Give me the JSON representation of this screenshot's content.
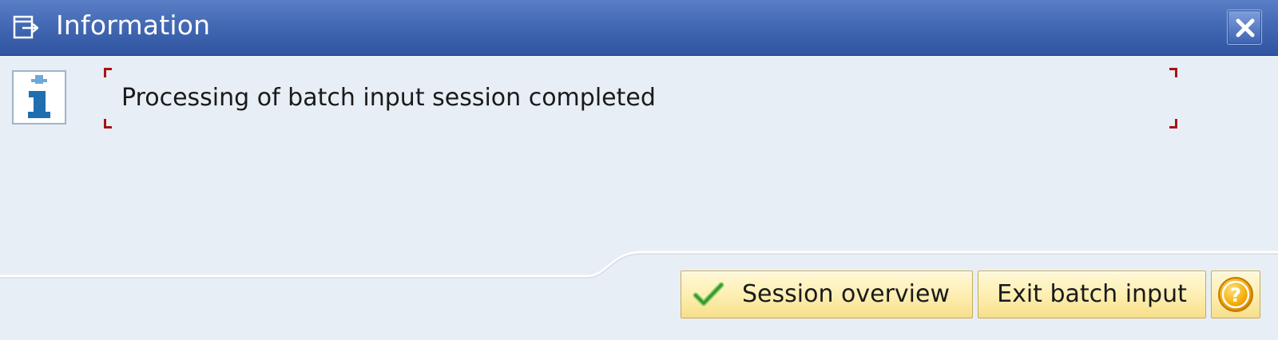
{
  "window": {
    "title": "Information",
    "title_icon": "dialog-window-icon",
    "close_icon": "close-icon"
  },
  "message": {
    "icon": "info-icon",
    "text": "Processing of batch input session completed"
  },
  "buttons": {
    "session_overview": {
      "label": "Session overview",
      "icon": "checkmark-icon"
    },
    "exit_batch_input": {
      "label": "Exit batch input"
    },
    "help": {
      "icon": "help-icon",
      "glyph": "?"
    }
  },
  "colors": {
    "titlebar": "#4469b4",
    "body": "#e8eef5",
    "button": "#fdeeaf",
    "focus_corner": "#a31515",
    "info_icon": "#1f6fb0",
    "check": "#3a9a2a",
    "help": "#f0a500"
  }
}
